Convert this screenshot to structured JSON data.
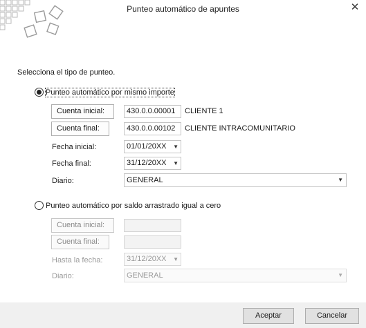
{
  "window": {
    "title": "Punteo automático de apuntes"
  },
  "heading": "Selecciona el tipo de punteo.",
  "option1": {
    "label": "Punteo automático por mismo importe",
    "selected": true,
    "cuenta_inicial": {
      "button": "Cuenta inicial:",
      "value": "430.0.0.00001",
      "name": "CLIENTE 1"
    },
    "cuenta_final": {
      "button": "Cuenta final:",
      "value": "430.0.0.00102",
      "name": "CLIENTE INTRACOMUNITARIO"
    },
    "fecha_inicial": {
      "label": "Fecha inicial:",
      "value": "01/01/20XX"
    },
    "fecha_final": {
      "label": "Fecha final:",
      "value": "31/12/20XX"
    },
    "diario": {
      "label": "Diario:",
      "value": "GENERAL"
    }
  },
  "option2": {
    "label": "Punteo automático por saldo arrastrado igual a cero",
    "selected": false,
    "cuenta_inicial": {
      "button": "Cuenta inicial:",
      "value": ""
    },
    "cuenta_final": {
      "button": "Cuenta final:",
      "value": ""
    },
    "hasta_fecha": {
      "label": "Hasta la fecha:",
      "value": "31/12/20XX"
    },
    "diario": {
      "label": "Diario:",
      "value": "GENERAL"
    }
  },
  "footer": {
    "accept": "Aceptar",
    "cancel": "Cancelar"
  },
  "icons": {
    "close": "close-icon",
    "logo": "squares-logo-icon",
    "dropdown": "chevron-down-icon"
  },
  "colors": {
    "footer_bg": "#f0f0f0",
    "button_bg": "#e1e1e1",
    "disabled_text": "#9a9a9a"
  }
}
